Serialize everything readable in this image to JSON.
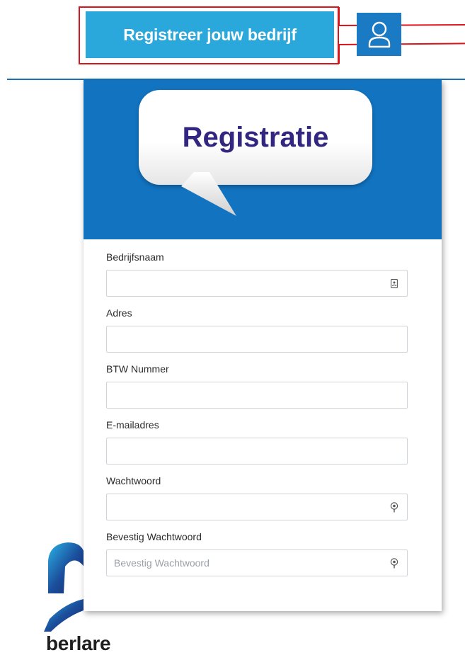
{
  "header": {
    "register_button_label": "Registreer jouw bedrijf",
    "user_button": "user-icon",
    "colors": {
      "register_button": "#2aa8db",
      "user_button": "#1a7ac4",
      "annotation": "#d9141b"
    }
  },
  "modal": {
    "title": "Registratie",
    "header_color": "#1273c0",
    "title_color": "#322680",
    "fields": [
      {
        "label": "Bedrijfsnaam",
        "value": "",
        "placeholder": "",
        "icon": "contact-card-icon"
      },
      {
        "label": "Adres",
        "value": "",
        "placeholder": "",
        "icon": ""
      },
      {
        "label": "BTW Nummer",
        "value": "",
        "placeholder": "",
        "icon": ""
      },
      {
        "label": "E-mailadres",
        "value": "",
        "placeholder": "",
        "icon": ""
      },
      {
        "label": "Wachtwoord",
        "value": "",
        "placeholder": "",
        "icon": "key-icon"
      },
      {
        "label": "Bevestig Wachtwoord",
        "value": "",
        "placeholder": "Bevestig Wachtwoord",
        "icon": "key-icon"
      }
    ]
  },
  "logo": {
    "text": "berlare"
  }
}
